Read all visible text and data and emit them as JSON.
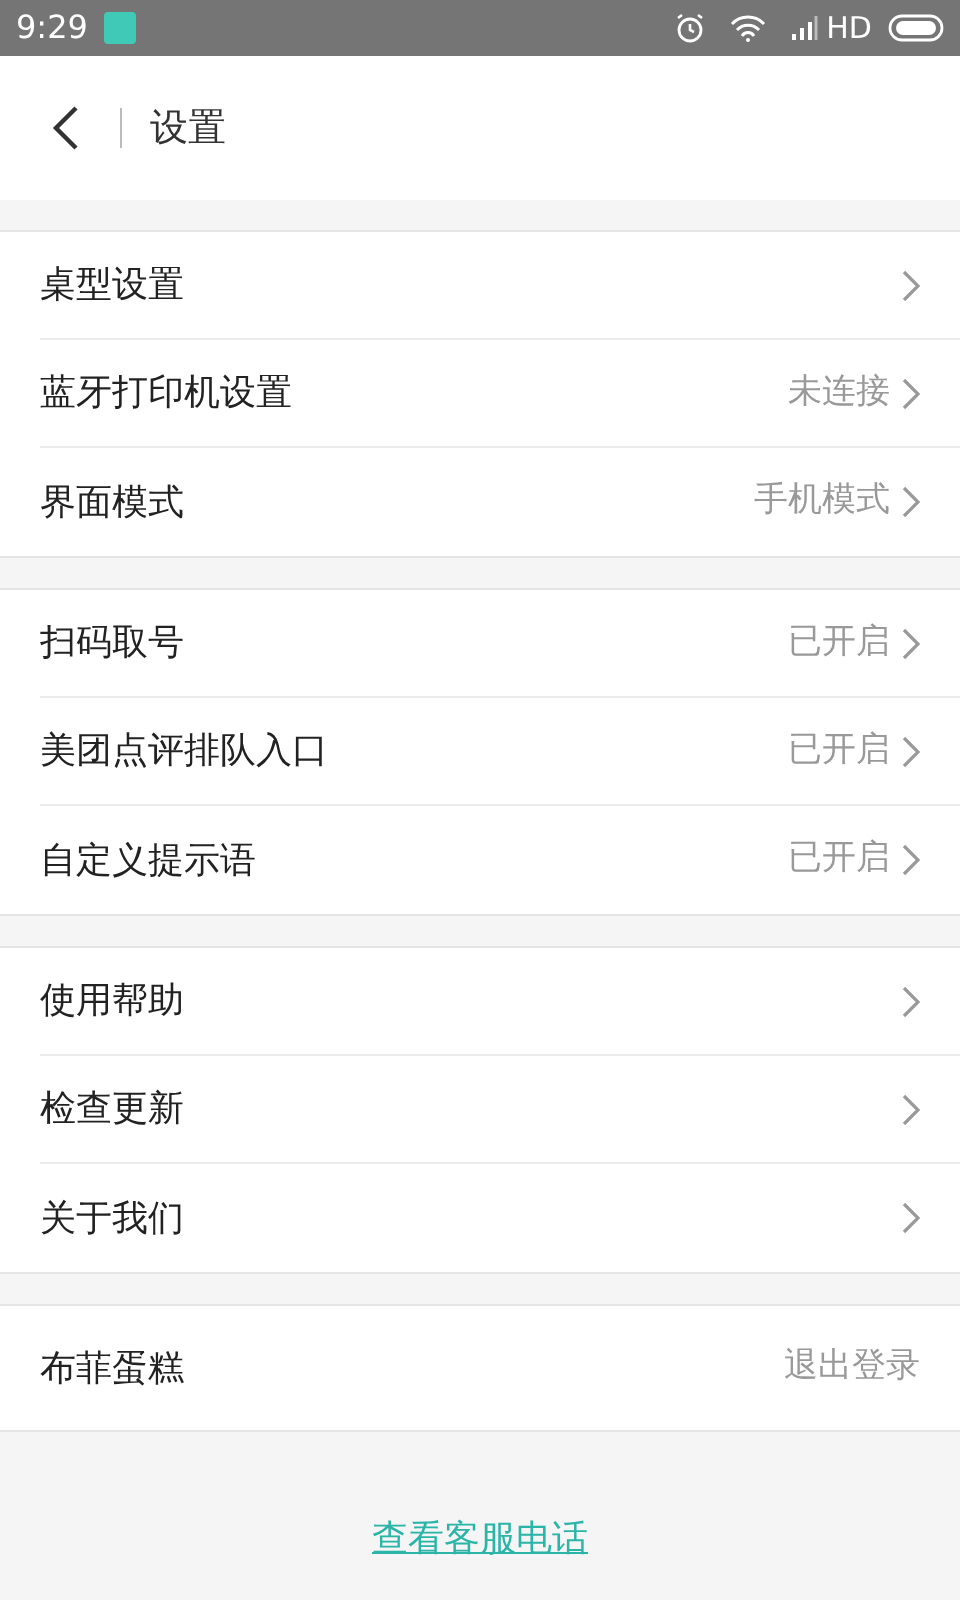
{
  "status_bar": {
    "time": "9:29",
    "network": "HD"
  },
  "header": {
    "title": "设置"
  },
  "groups": [
    {
      "rows": [
        {
          "label": "桌型设置"
        },
        {
          "label": "蓝牙打印机设置",
          "value": "未连接"
        },
        {
          "label": "界面模式",
          "value": "手机模式"
        }
      ]
    },
    {
      "rows": [
        {
          "label": "扫码取号",
          "value": "已开启"
        },
        {
          "label": "美团点评排队入口",
          "value": "已开启"
        },
        {
          "label": "自定义提示语",
          "value": "已开启"
        }
      ]
    },
    {
      "rows": [
        {
          "label": "使用帮助"
        },
        {
          "label": "检查更新"
        },
        {
          "label": "关于我们"
        }
      ]
    }
  ],
  "account": {
    "name": "布菲蛋糕",
    "action": "退出登录"
  },
  "footer_link": "查看客服电话"
}
